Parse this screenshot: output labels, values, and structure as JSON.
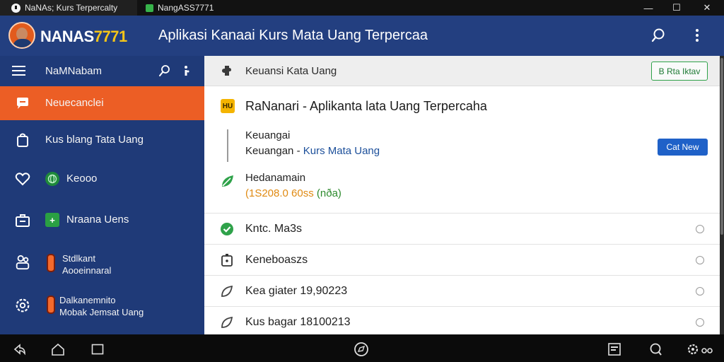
{
  "tabs": [
    {
      "title": "NaNAs; Kurs Terpercalty"
    },
    {
      "title": "NangASS7771"
    }
  ],
  "window_controls": {
    "minimize": "—",
    "maximize": "☐",
    "close": "✕"
  },
  "header": {
    "brand_text": "NANAS",
    "brand_number": "7771",
    "title": "Aplikasi Kanaai Kurs Mata Uang Terpercaa"
  },
  "sidebar": {
    "top_label": "NaMNabam",
    "items": [
      {
        "label": "Neuecanclei",
        "icon": "chat-bubble-icon",
        "active": true
      },
      {
        "label": "Kus blang Tata Uang",
        "icon": "bag-icon",
        "active": false
      },
      {
        "label": "Keooo",
        "icon": "heart-icon",
        "badge_icon": "globe-icon",
        "active": false
      },
      {
        "label": "Nraana Uens",
        "icon": "briefcase-icon",
        "badge_icon": "plus-icon",
        "active": false
      },
      {
        "label_line1": "Stdlkant",
        "label_line2": "Aooeinnaral",
        "icon": "people-icon",
        "active": false
      },
      {
        "label_line1": "Dalkanemnito",
        "label_line2": "Mobak Jemsat Uang",
        "icon": "settings-icon",
        "active": false
      }
    ]
  },
  "main": {
    "breadcrumb": "Keuansi Kata Uang",
    "top_button": "B Rta Iktav",
    "card": {
      "badge": "HU",
      "title": "RaNanari - Aplikanta lata Uang Terpercaha",
      "line1": "Keuangai",
      "line2_prefix": "Keuangan - ",
      "line2_link": "Kurs Mata Uang",
      "button": "Cat New",
      "status_label": "Hedanamain",
      "amount": "(1S208.0 60ss",
      "amount_suffix": "(nða)"
    },
    "rows": [
      {
        "label": "Kntc. Ma3s",
        "icon": "check-circle-icon"
      },
      {
        "label": "Keneboaszs",
        "icon": "timer-icon"
      },
      {
        "label": "Kea giater 19,90223",
        "icon": "leaf-icon"
      },
      {
        "label": "Kus bagar 18100213",
        "icon": "leaf-icon"
      }
    ]
  },
  "colors": {
    "header_bg": "#233f80",
    "sidebar_bg": "#1f3a78",
    "active_item": "#ec5e25",
    "primary_button": "#1f61c8",
    "success_green": "#2fa24a"
  }
}
